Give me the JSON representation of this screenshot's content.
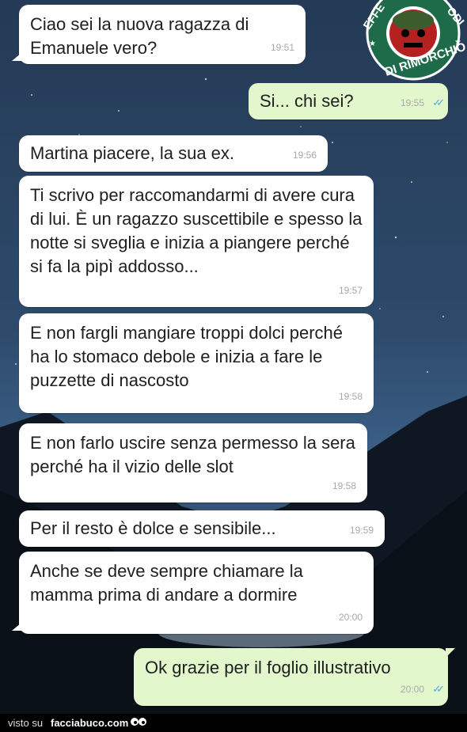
{
  "messages": [
    {
      "dir": "in",
      "text": "Ciao sei la nuova ragazza di Emanuele vero?",
      "time": "19:51"
    },
    {
      "dir": "out",
      "text": "Si... chi sei?",
      "time": "19:55"
    },
    {
      "dir": "in",
      "text": "Martina piacere, la sua ex.",
      "time": "19:56"
    },
    {
      "dir": "in",
      "text": "Ti scrivo per raccomandarmi di avere cura di lui. È un ragazzo suscettibile e spesso la notte si sveglia e inizia a piangere perché si fa la pipì addosso...",
      "time": "19:57"
    },
    {
      "dir": "in",
      "text": "E non fargli mangiare troppi dolci perché ha lo stomaco debole e inizia a fare le puzzette di nascosto",
      "time": "19:58"
    },
    {
      "dir": "in",
      "text": "E non farlo uscire senza permesso la sera perché ha il vizio delle slot",
      "time": "19:58"
    },
    {
      "dir": "in",
      "text": "Per il resto è dolce e sensibile...",
      "time": "19:59"
    },
    {
      "dir": "in",
      "text": "Anche se deve sempre chiamare la mamma prima di andare a dormire",
      "time": "20:00"
    },
    {
      "dir": "out",
      "text": "Ok grazie per il foglio illustrativo",
      "time": "20:00"
    }
  ],
  "read_receipt_icon": "double-check-icon",
  "read_receipt_color": "#4fa7de",
  "logo": {
    "text_top": "EFFETTI COLLATERALI",
    "text_bottom": "DI RIMORCHIO",
    "color": "#1e6b4a"
  },
  "footer": {
    "prefix": "visto su",
    "site": "facciabuco.com"
  }
}
